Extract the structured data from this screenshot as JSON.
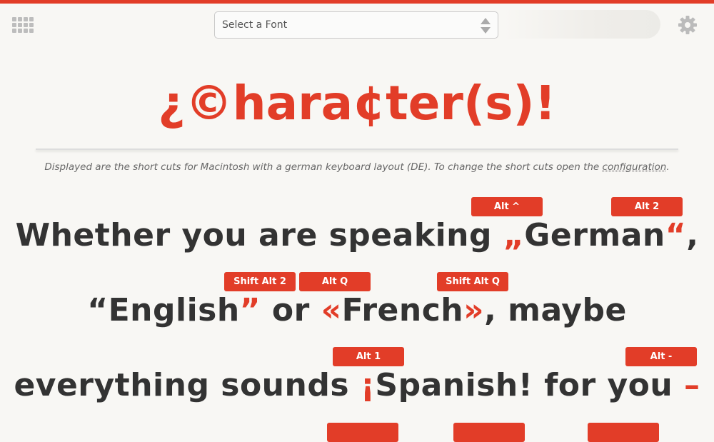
{
  "header": {
    "font_select": {
      "label": "Select a Font"
    },
    "menu_icon": "grid-icon",
    "settings_icon": "gear-icon"
  },
  "title": "¿©hara¢ter(s)!",
  "notice": {
    "text_before": "Displayed are the short cuts for Macintosh with a german keyboard layout (DE). To change the short cuts open the ",
    "config_link": "configuration",
    "text_after": "."
  },
  "shortcuts": {
    "alt_caret": "Alt ^",
    "alt_2": "Alt 2",
    "shift_alt_2": "Shift Alt 2",
    "alt_q": "Alt Q",
    "shift_alt_q": "Shift Alt Q",
    "alt_1": "Alt 1",
    "alt_dash": "Alt -"
  },
  "sentence": {
    "l1_a": "Whether you are speaking ",
    "l1_q1": "„",
    "l1_b": "German",
    "l1_q2": "“",
    "l1_c": ",",
    "l2_q1": "“",
    "l2_a": "English",
    "l2_q2": "”",
    "l2_b": " or ",
    "l2_g1": "«",
    "l2_c": "French",
    "l2_g2": "»",
    "l2_d": ", maybe",
    "l3_a": "everything sounds ",
    "l3_excl": "¡",
    "l3_b": "Spanish! for you ",
    "l3_dash": "–"
  },
  "colors": {
    "accent": "#e23d28",
    "text": "#333333",
    "background": "#f8f7f4"
  }
}
